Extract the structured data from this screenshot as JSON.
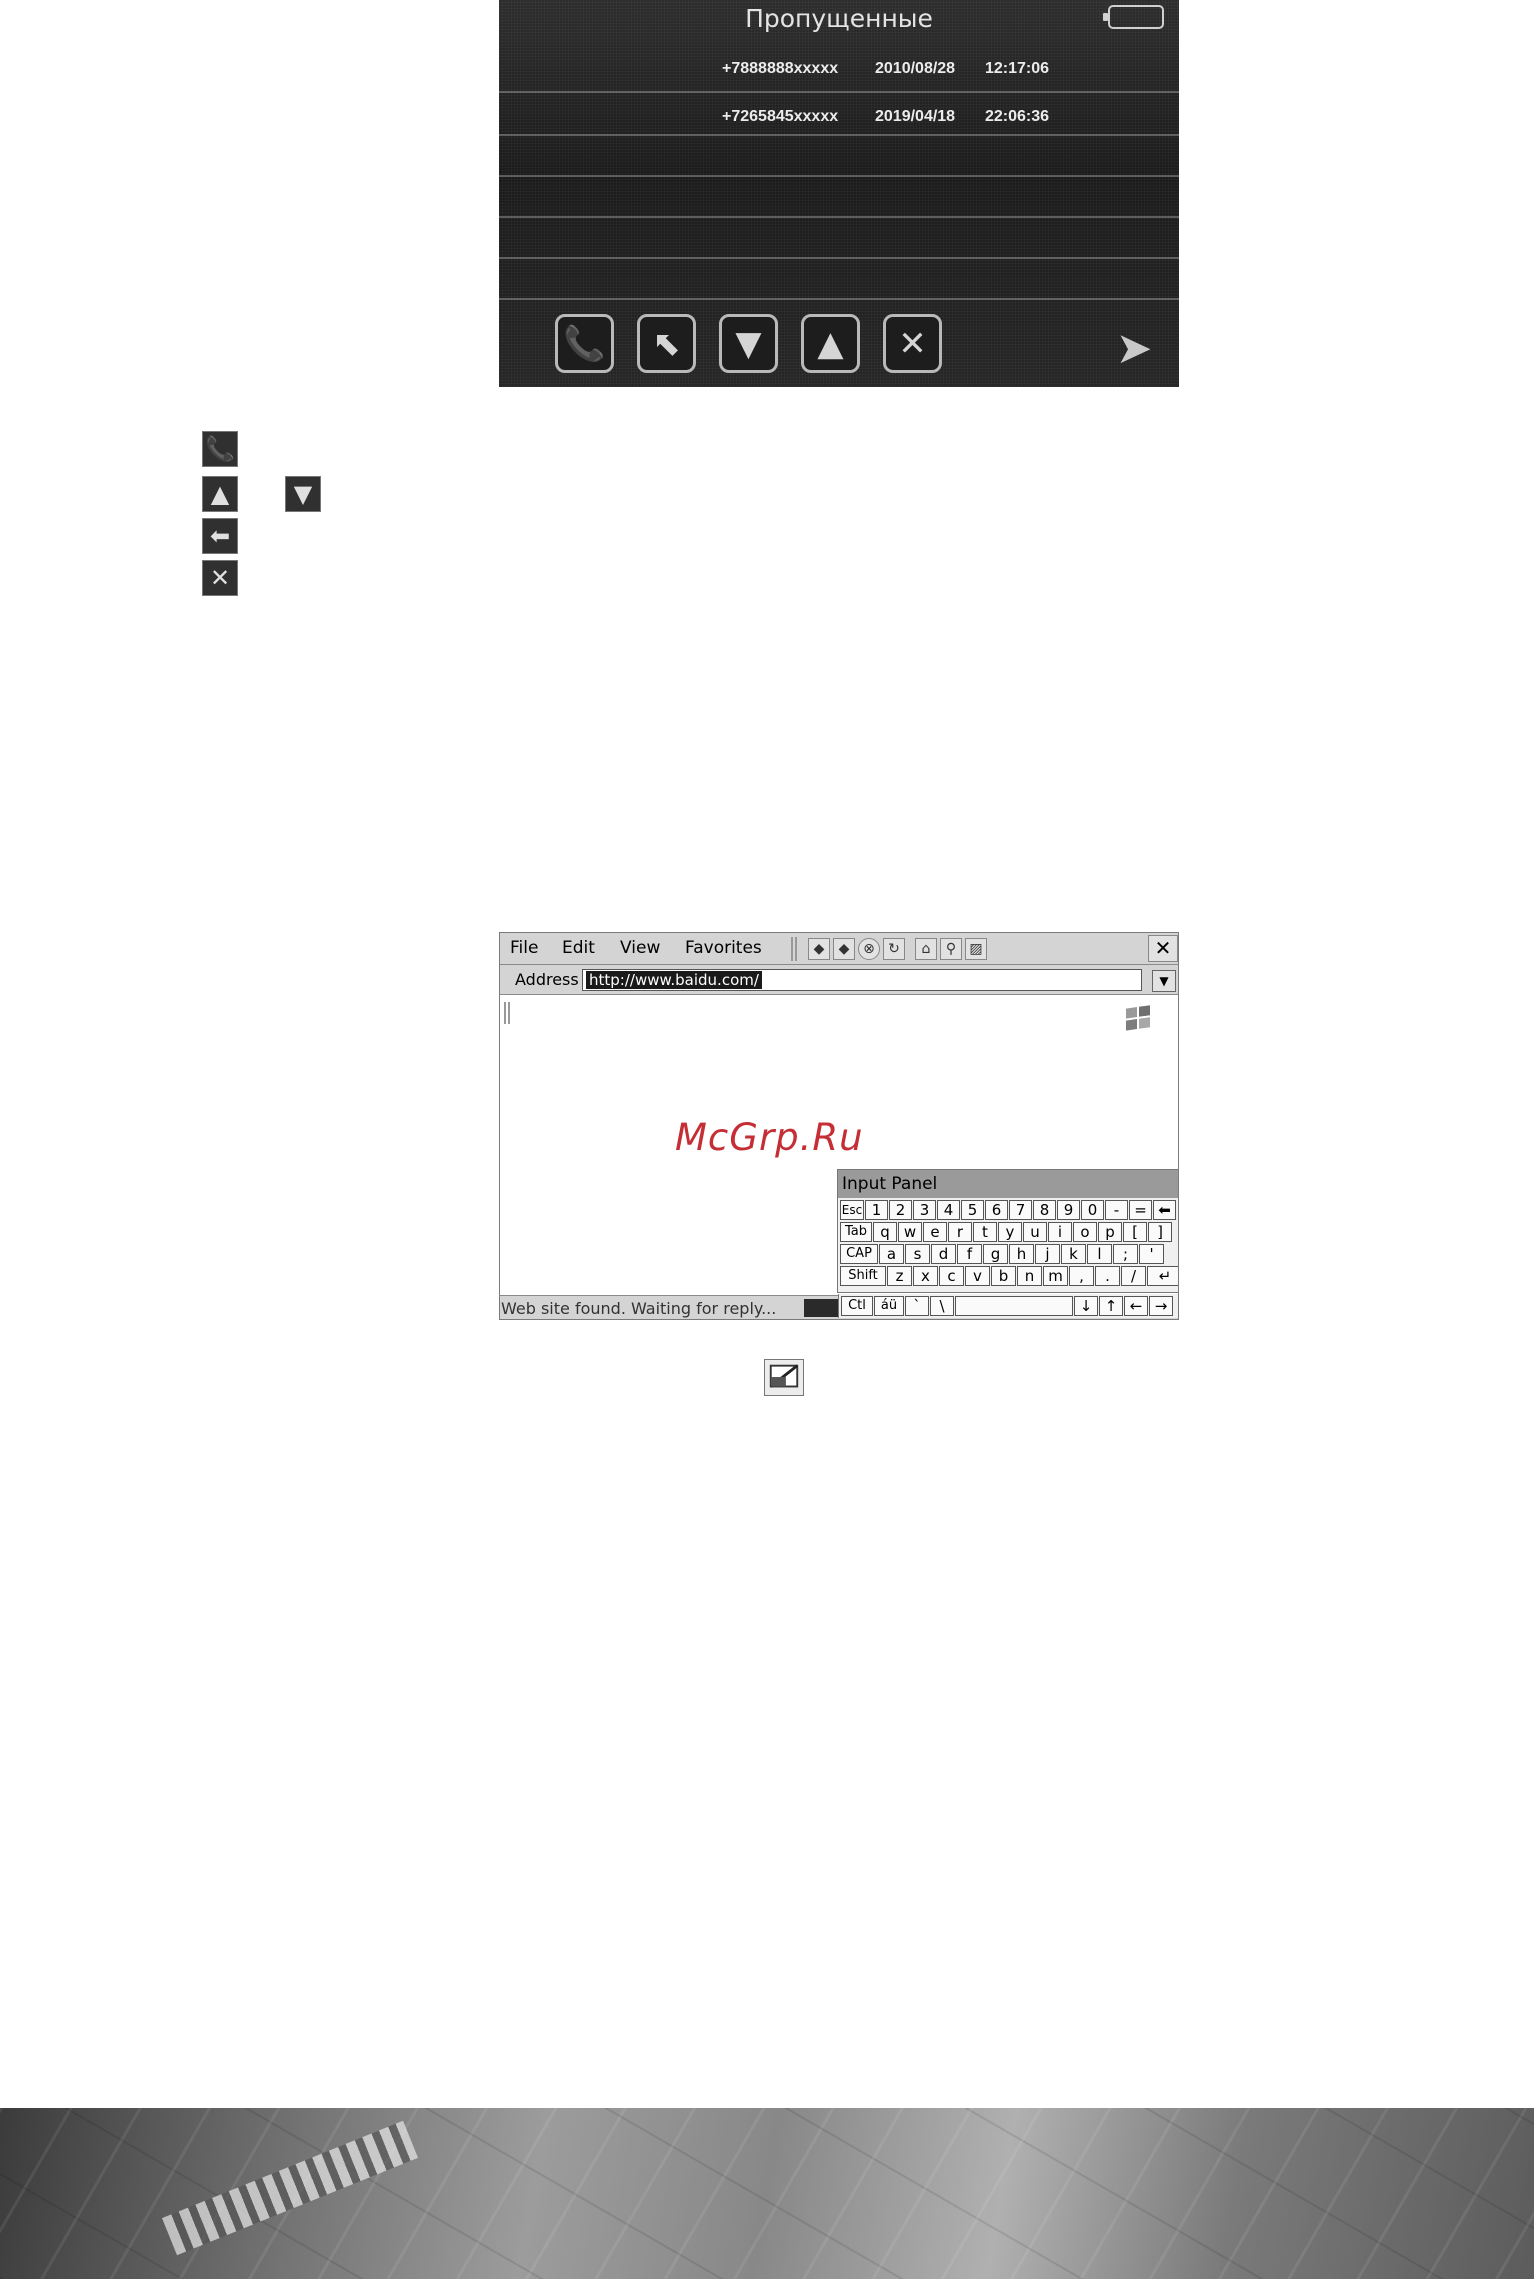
{
  "calls_screen": {
    "title": "Пропущенные",
    "rows": [
      {
        "number": "+7888888xxxxx",
        "date": "2010/08/28",
        "time": "12:17:06"
      },
      {
        "number": "+7265845xxxxx",
        "date": "2019/04/18",
        "time": "22:06:36"
      }
    ],
    "toolbar": [
      {
        "name": "call-icon",
        "glyph": "📞"
      },
      {
        "name": "back-icon",
        "glyph": "⬉"
      },
      {
        "name": "scroll-down-icon",
        "glyph": "▼"
      },
      {
        "name": "scroll-up-icon",
        "glyph": "▲"
      },
      {
        "name": "delete-icon",
        "glyph": "✕"
      }
    ],
    "next_glyph": "➤"
  },
  "legend": {
    "call_glyph": "📞",
    "up_glyph": "▲",
    "down_glyph": "▼",
    "back_glyph": "⬅",
    "delete_glyph": "✕"
  },
  "browser": {
    "menu": [
      "File",
      "Edit",
      "View",
      "Favorites"
    ],
    "address_label": "Address",
    "address_value": "http://www.baidu.com/",
    "watermark": "McGrp.Ru",
    "status": "Web site found. Waiting for reply...",
    "input_panel": {
      "title": "Input Panel",
      "rows": [
        [
          "Esc",
          "1",
          "2",
          "3",
          "4",
          "5",
          "6",
          "7",
          "8",
          "9",
          "0",
          "-",
          "=",
          "⬅"
        ],
        [
          "Tab",
          "q",
          "w",
          "e",
          "r",
          "t",
          "y",
          "u",
          "i",
          "o",
          "p",
          "[",
          "]"
        ],
        [
          "CAP",
          "a",
          "s",
          "d",
          "f",
          "g",
          "h",
          "j",
          "k",
          "l",
          ";",
          "'"
        ],
        [
          "Shift",
          "z",
          "x",
          "c",
          "v",
          "b",
          "n",
          "m",
          ",",
          ".",
          "/",
          "↵"
        ],
        [
          "Ctl",
          "áü",
          "`",
          "\\",
          " ",
          "↓",
          "↑",
          "←",
          "→"
        ]
      ]
    }
  }
}
